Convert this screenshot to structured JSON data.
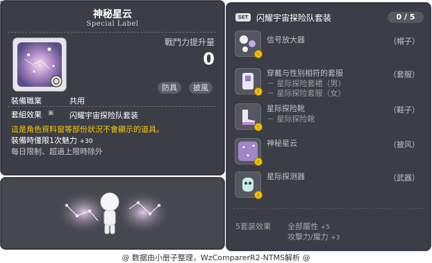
{
  "meta": {
    "id_label": "01103544"
  },
  "item": {
    "name": "神秘星云",
    "subtitle": "Special Label",
    "power_label": "戰鬥力提升量",
    "power_value": "0",
    "slots": [
      "防具",
      "披風"
    ],
    "job_label": "裝備職業",
    "job_value": "共用",
    "set_label": "套組效果",
    "set_value": "闪耀宇宙探险队套装",
    "warning": "這是角色資料窗等部份狀況不會顯示的道具。",
    "charm_text": "裝備時僅限1次魅力",
    "charm_value": "+30",
    "limit_text": "每日限制、超過上限時除外"
  },
  "set": {
    "badge": "SET",
    "name": "闪耀宇宙探险队套装",
    "count": "0 / 5",
    "items": [
      {
        "name": "信号放大器",
        "slot": "（帽子）",
        "subs": []
      },
      {
        "name": "穿戴与性别相符的套服",
        "slot": "（套服）",
        "subs": [
          "－ 星际探险套裙（男）",
          "－ 星际探险套服（女）"
        ]
      },
      {
        "name": "星际探险靴",
        "slot": "（鞋子）",
        "subs": [
          "－ 星际探险靴"
        ]
      },
      {
        "name": "神秘星云",
        "slot": "（披风）",
        "subs": []
      },
      {
        "name": "星际探测器",
        "slot": "（武器）",
        "subs": []
      }
    ],
    "bonus_label": "5套装效果",
    "bonus_lines": [
      {
        "text": "全部屬性",
        "value": "+5"
      },
      {
        "text": "攻擊力/魔力",
        "value": "+3"
      }
    ]
  },
  "footer": "@ 数据由小册子整理，WzComparerR2-NTMS解析 @",
  "colors": {
    "panel": "#3b3e47",
    "warning": "#ffc600",
    "coin": "#f2c200"
  }
}
